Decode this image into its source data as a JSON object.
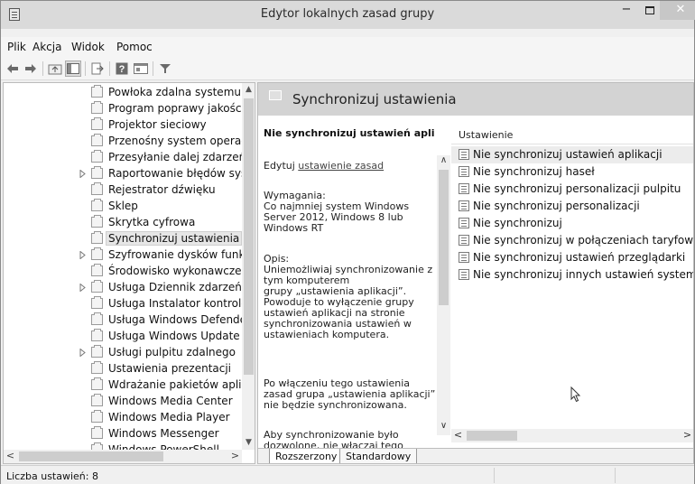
{
  "window": {
    "title": "Edytor lokalnych zasad grupy",
    "minimize": "−",
    "close": "✕"
  },
  "menu": [
    "Plik",
    "Akcja",
    "Widok",
    "Pomoc"
  ],
  "toolbar": [
    "back-icon",
    "forward-icon",
    "up-folder-icon",
    "show-hide-tree-icon",
    "export-list-icon",
    "help-icon",
    "properties-icon",
    "filter-icon"
  ],
  "tree": {
    "items": [
      {
        "label": "Powłoka zdalna systemu Wi",
        "expandable": false
      },
      {
        "label": "Program poprawy jakości o",
        "expandable": false
      },
      {
        "label": "Projektor sieciowy",
        "expandable": false
      },
      {
        "label": "Przenośny system operacyjn",
        "expandable": false
      },
      {
        "label": "Przesyłanie dalej zdarzeń",
        "expandable": false
      },
      {
        "label": "Raportowanie błędów syste",
        "expandable": true
      },
      {
        "label": "Rejestrator dźwięku",
        "expandable": false
      },
      {
        "label": "Sklep",
        "expandable": false
      },
      {
        "label": "Skrytka cyfrowa",
        "expandable": false
      },
      {
        "label": "Synchronizuj ustawienia",
        "expandable": false,
        "selected": true
      },
      {
        "label": "Szyfrowanie dysków funkcja",
        "expandable": true
      },
      {
        "label": "Środowisko wykonawcze ap",
        "expandable": false
      },
      {
        "label": "Usługa Dziennik zdarzeń",
        "expandable": true
      },
      {
        "label": "Usługa Instalator kontrolek",
        "expandable": false
      },
      {
        "label": "Usługa Windows Defender",
        "expandable": false
      },
      {
        "label": "Usługa Windows Update",
        "expandable": false
      },
      {
        "label": "Usługi pulpitu zdalnego",
        "expandable": true
      },
      {
        "label": "Ustawienia prezentacji",
        "expandable": false
      },
      {
        "label": "Wdrażanie pakietów aplikac",
        "expandable": false
      },
      {
        "label": "Windows Media Center",
        "expandable": false
      },
      {
        "label": "Windows Media Player",
        "expandable": false
      },
      {
        "label": "Windows Messenger",
        "expandable": false
      },
      {
        "label": "Windows PowerShell",
        "expandable": false
      }
    ]
  },
  "details": {
    "header": "Synchronizuj ustawienia",
    "selected_title": "Nie synchronizuj ustawień aplikacji",
    "edit_prefix": "Edytuj ",
    "edit_link": "ustawienie zasad",
    "requirements_lines": [
      "Wymagania:",
      "Co najmniej system Windows",
      "Server 2012, Windows 8 lub",
      "Windows RT"
    ],
    "description_lines": [
      "Opis:",
      "Uniemożliwiaj synchronizowanie z",
      "tym komputerem",
      "grupy „ustawienia aplikacji”.",
      "Powoduje to wyłączenie grupy",
      "ustawień aplikacji na stronie",
      "synchronizowania ustawień w",
      "ustawieniach komputera."
    ],
    "enabled_lines": [
      "Po włączeniu tego ustawienia",
      "zasad grupa „ustawienia aplikacji”",
      "nie będzie synchronizowana."
    ],
    "more_lines": [
      "Aby synchronizowanie było",
      "dozwolone, nie włączaj tego"
    ]
  },
  "list": {
    "column_header": "Ustawienie",
    "items": [
      "Nie synchronizuj ustawień aplikacji",
      "Nie synchronizuj haseł",
      "Nie synchronizuj personalizacji pulpitu",
      "Nie synchronizuj personalizacji",
      "Nie synchronizuj",
      "Nie synchronizuj w połączeniach taryfowych",
      "Nie synchronizuj ustawień przeglądarki",
      "Nie synchronizuj innych ustawień systemu Wir"
    ]
  },
  "tabs": [
    "Rozszerzony",
    "Standardowy"
  ],
  "status": {
    "text": "Liczba ustawień: 8"
  }
}
